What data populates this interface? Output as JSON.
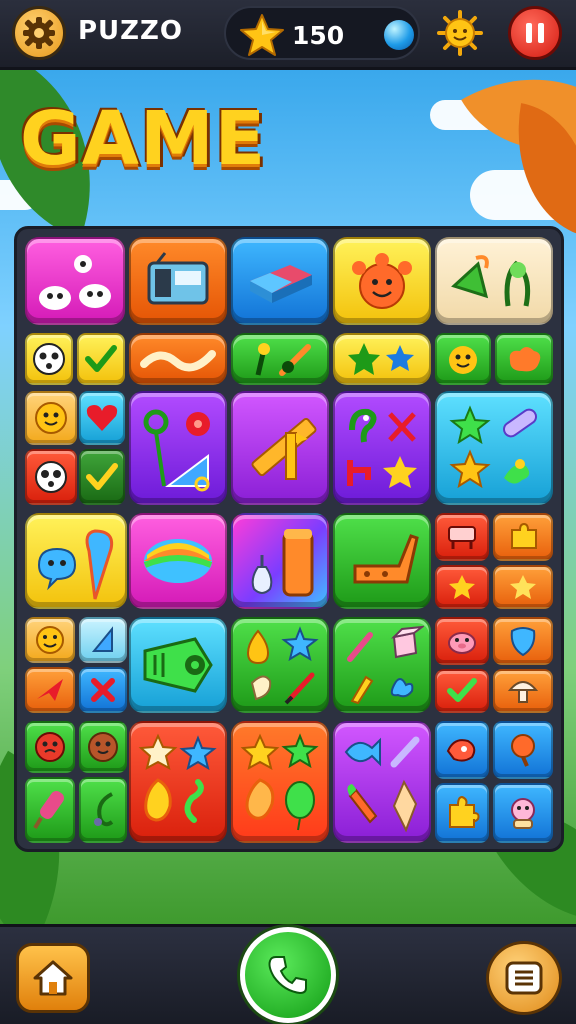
{
  "header": {
    "title": "PUZZO",
    "score": "150",
    "settings_icon": "gear-icon",
    "star_icon": "star-icon",
    "gem_icon": "blue-gem-icon",
    "sun_icon": "sun-icon",
    "pause_icon": "pause-icon"
  },
  "banner": {
    "text": "GAME"
  },
  "footer": {
    "home_icon": "home-icon",
    "call_icon": "phone-icon",
    "menu_icon": "menu-icon"
  },
  "colors": {
    "accent_yellow": "#ffd21f",
    "pause_red": "#d51c12",
    "call_green": "#119b14",
    "board_bg": "#2c3140"
  },
  "board": {
    "rows": 6,
    "cols": 5,
    "tiles": [
      {
        "name": "tile-blob-faces",
        "color": "magenta"
      },
      {
        "name": "tile-radio",
        "color": "orange"
      },
      {
        "name": "tile-eraser",
        "color": "blue"
      },
      {
        "name": "tile-orange-creature",
        "color": "yellow"
      },
      {
        "name": "tile-green-shapes",
        "color": "cream"
      },
      {
        "name": "tile-face-and-check",
        "color": "mixed"
      },
      {
        "name": "tile-wave",
        "color": "orange"
      },
      {
        "name": "tile-tools",
        "color": "green"
      },
      {
        "name": "tile-green-star-blue-star",
        "color": "yellow"
      },
      {
        "name": "tile-smiley-and-blob",
        "color": "green"
      },
      {
        "name": "tile-quad-face-heart",
        "color": "mixed"
      },
      {
        "name": "tile-geometry",
        "color": "purple"
      },
      {
        "name": "tile-ruler",
        "color": "violet"
      },
      {
        "name": "tile-bird-scissors",
        "color": "purple"
      },
      {
        "name": "tile-star-brush",
        "color": "cyan"
      },
      {
        "name": "tile-chat-drop",
        "color": "yellow"
      },
      {
        "name": "tile-rainbow-ball",
        "color": "magenta"
      },
      {
        "name": "tile-bottle",
        "color": "rainbow"
      },
      {
        "name": "tile-chair",
        "color": "green"
      },
      {
        "name": "tile-chair-stars",
        "color": "mixed"
      },
      {
        "name": "tile-quad-smile-cross",
        "color": "mixed"
      },
      {
        "name": "tile-machine",
        "color": "blue"
      },
      {
        "name": "tile-drops-star",
        "color": "green"
      },
      {
        "name": "tile-brush-cube",
        "color": "green"
      },
      {
        "name": "tile-pig-check",
        "color": "mixed"
      },
      {
        "name": "tile-face-pops",
        "color": "mixed"
      },
      {
        "name": "tile-stars-flames",
        "color": "red"
      },
      {
        "name": "tile-stars-balloons",
        "color": "sun"
      },
      {
        "name": "tile-fish-carrot",
        "color": "purple"
      },
      {
        "name": "tile-puzzle-pieces",
        "color": "mixed"
      }
    ]
  }
}
